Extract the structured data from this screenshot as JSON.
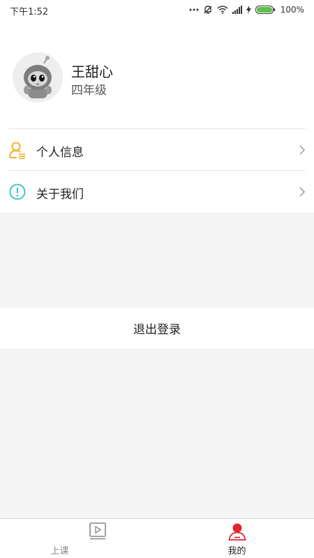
{
  "status_bar": {
    "time": "下午1:52",
    "battery": "100%",
    "icons": [
      "dots-icon",
      "mute-icon",
      "wifi-icon",
      "signal-icon",
      "charging-icon",
      "battery-icon"
    ]
  },
  "profile": {
    "name": "王甜心",
    "grade": "四年级",
    "avatar_icon": "robot-avatar-icon"
  },
  "menu": {
    "items": [
      {
        "label": "个人信息",
        "icon": "user-info-icon",
        "icon_color": "#f0b429"
      },
      {
        "label": "关于我们",
        "icon": "info-circle-icon",
        "icon_color": "#2fc0c0"
      }
    ]
  },
  "logout_label": "退出登录",
  "tabbar": {
    "tabs": [
      {
        "label": "上课",
        "icon": "video-lesson-icon",
        "active": false
      },
      {
        "label": "我的",
        "icon": "profile-icon",
        "active": true
      }
    ]
  },
  "colors": {
    "accent": "#e0262d",
    "background": "#f4f4f4",
    "battery_green": "#5cc24a"
  }
}
